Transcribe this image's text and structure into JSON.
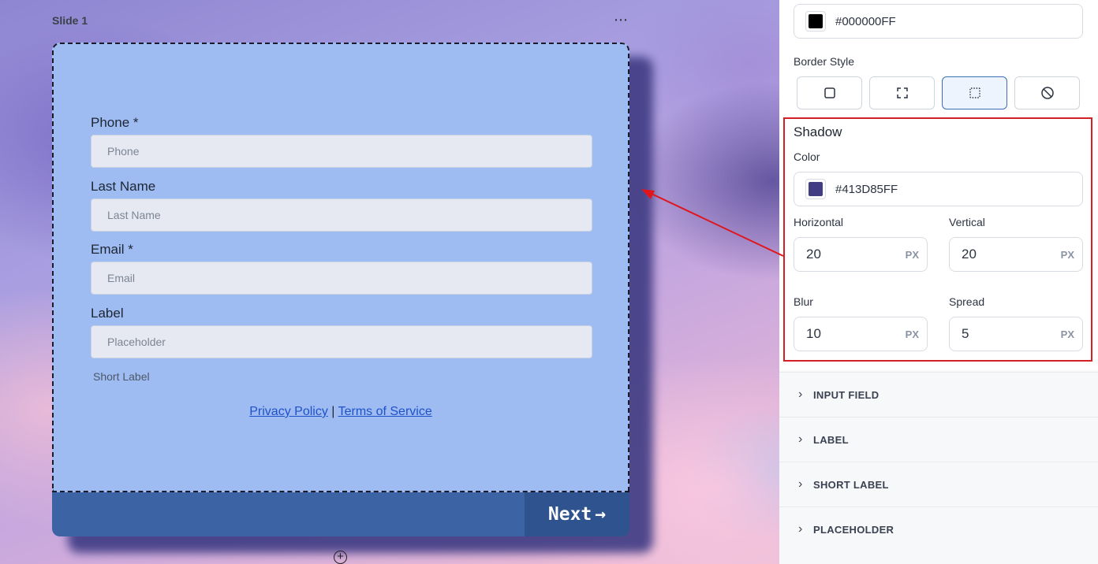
{
  "canvas": {
    "slide_title": "Slide 1",
    "menu_icon": "⋯",
    "fields": [
      {
        "label": "Phone *",
        "placeholder": "Phone"
      },
      {
        "label": "Last Name",
        "placeholder": "Last Name"
      },
      {
        "label": "Email *",
        "placeholder": "Email"
      },
      {
        "label": "Label",
        "placeholder": "Placeholder"
      }
    ],
    "short_label": "Short Label",
    "privacy_link": "Privacy Policy",
    "link_separator": "|",
    "terms_link": "Terms of Service",
    "next_button": "Next",
    "next_arrow": "→",
    "add_icon": "+"
  },
  "panel": {
    "border_color": {
      "value": "#000000FF",
      "hex": "#000000"
    },
    "border_style": {
      "label": "Border Style",
      "options": [
        "solid-square-icon",
        "corners-icon",
        "dotted-square-icon",
        "no-border-icon"
      ],
      "active_index": 2
    },
    "shadow": {
      "title": "Shadow",
      "color_label": "Color",
      "color": {
        "value": "#413D85FF",
        "hex": "#413D85"
      },
      "horizontal": {
        "label": "Horizontal",
        "value": "20",
        "unit": "PX"
      },
      "vertical": {
        "label": "Vertical",
        "value": "20",
        "unit": "PX"
      },
      "blur": {
        "label": "Blur",
        "value": "10",
        "unit": "PX"
      },
      "spread": {
        "label": "Spread",
        "value": "5",
        "unit": "PX"
      }
    },
    "sections": [
      "INPUT FIELD",
      "LABEL",
      "SHORT LABEL",
      "PLACEHOLDER"
    ]
  },
  "annotation": {
    "color": "#e0161d"
  }
}
